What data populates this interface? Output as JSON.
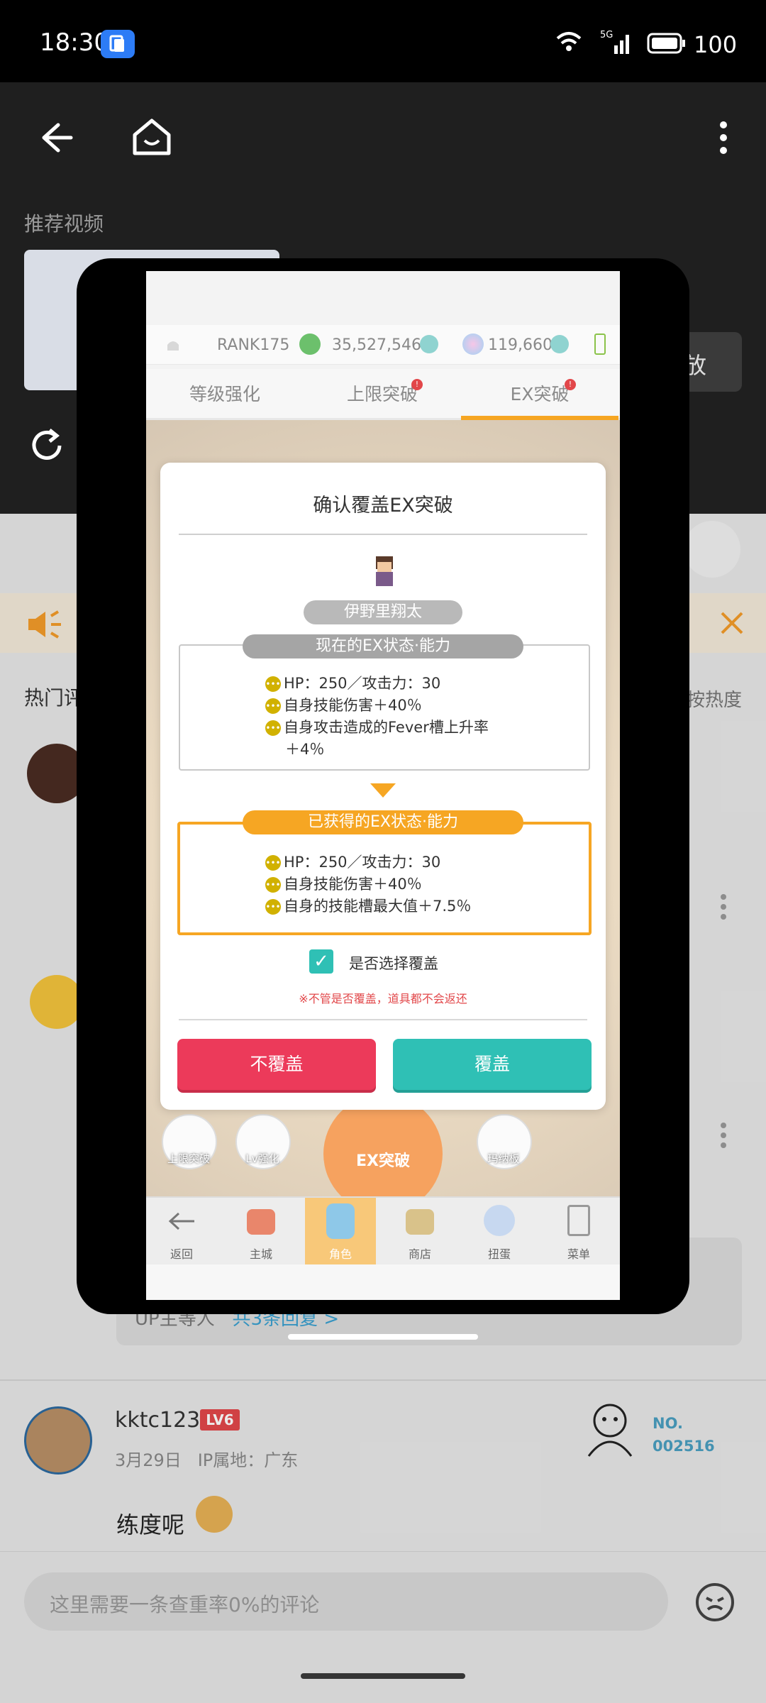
{
  "status_bar": {
    "time": "18:30",
    "network": "5G",
    "battery": "100"
  },
  "bili": {
    "recommend_label": "推荐视频",
    "play_button_partial": "放",
    "hot_comments_label": "热门评论",
    "sort_label": "按热度",
    "reply_summary": {
      "prefix": "UP主等人",
      "link": "共3条回复 >"
    },
    "comment2": {
      "username": "kktc123",
      "level": "LV6",
      "date": "3月29日",
      "ip": "IP属地：广东",
      "fan_no_label": "NO.",
      "fan_no_value": "002516",
      "text": "练度呢"
    },
    "comment_input_placeholder": "这里需要一条查重率0%的评论"
  },
  "game": {
    "rank": "RANK175",
    "coins": "35,527,546",
    "gems": "119,660",
    "tabs": [
      {
        "label": "等级强化",
        "has_dot": false
      },
      {
        "label": "上限突破",
        "has_dot": true
      },
      {
        "label": "EX突破",
        "has_dot": true
      }
    ],
    "dialog": {
      "title": "确认覆盖EX突破",
      "character_name": "伊野里翔太",
      "current_label": "现在的EX状态·能力",
      "current_stats": [
        "HP：250／攻击力：30",
        "自身技能伤害＋40％",
        "自身攻击造成的Fever槽上升率",
        "＋4％"
      ],
      "new_label": "已获得的EX状态·能力",
      "new_stats": [
        "HP：250／攻击力：30",
        "自身技能伤害＋40％",
        "自身的技能槽最大值＋7.5％"
      ],
      "checkbox_label": "是否选择覆盖",
      "warning": "※不管是否覆盖，道具都不会返还",
      "btn_no": "不覆盖",
      "btn_yes": "覆盖"
    },
    "ex_button_label": "EX突破",
    "side_buttons": {
      "limit_break": "上限突破",
      "lv_up": "Lv强化",
      "manaboard": "玛纳板"
    },
    "nav": [
      "返回",
      "主城",
      "角色",
      "商店",
      "扭蛋",
      "菜单"
    ]
  },
  "colors": {
    "accent_orange": "#f6a623",
    "teal": "#2fc0b5",
    "red": "#ec3a5a"
  }
}
